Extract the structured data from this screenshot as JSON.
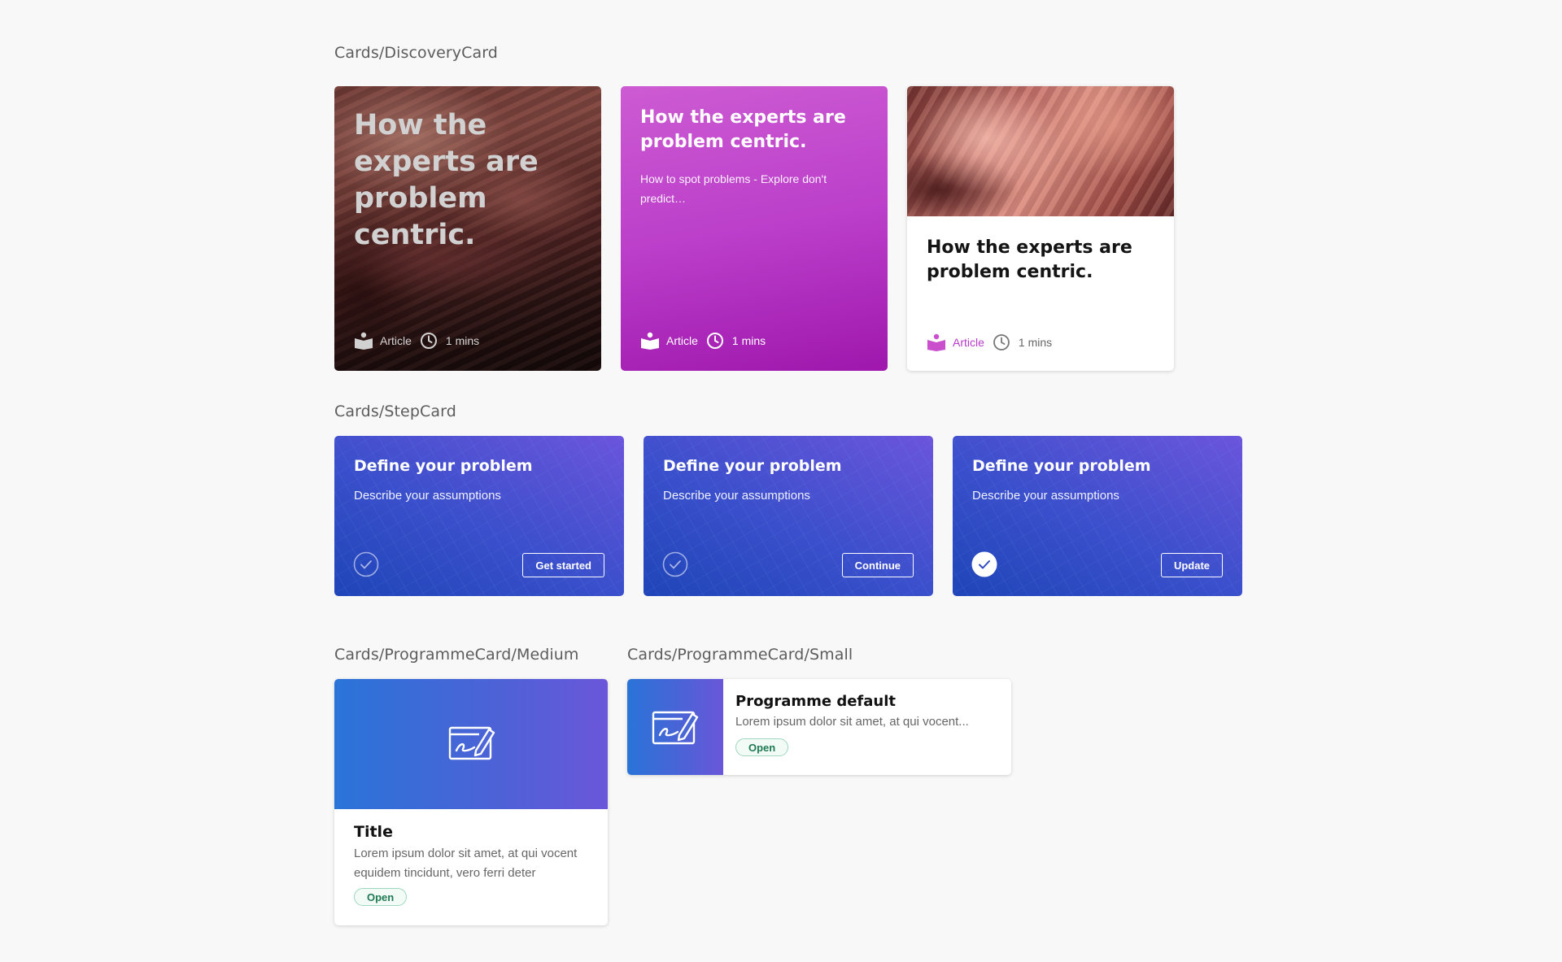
{
  "sections": {
    "discovery": "Cards/DiscoveryCard",
    "step": "Cards/StepCard",
    "programme_medium": "Cards/ProgrammeCard/Medium",
    "programme_small": "Cards/ProgrammeCard/Small"
  },
  "discovery_cards": [
    {
      "title": "How the experts are problem centric.",
      "type": "Article",
      "duration": "1 mins"
    },
    {
      "title": "How the experts are problem centric.",
      "description": "How to spot problems - Explore don't predict…",
      "type": "Article",
      "duration": "1 mins"
    },
    {
      "title": "How the experts are problem centric.",
      "type": "Article",
      "duration": "1 mins"
    }
  ],
  "step_cards": [
    {
      "title": "Define your problem",
      "subtitle": "Describe your assumptions",
      "button": "Get started",
      "completed": false
    },
    {
      "title": "Define your problem",
      "subtitle": "Describe your assumptions",
      "button": "Continue",
      "completed": false
    },
    {
      "title": "Define your problem",
      "subtitle": "Describe your assumptions",
      "button": "Update",
      "completed": true
    }
  ],
  "programme_medium": {
    "title": "Title",
    "description": "Lorem ipsum dolor sit amet, at qui vocent equidem tincidunt, vero ferri deter",
    "status": "Open"
  },
  "programme_small": {
    "title": "Programme default",
    "description": "Lorem ipsum dolor sit amet, at qui vocent...",
    "status": "Open"
  },
  "colors": {
    "background": "#f8f8f8",
    "discovery_magenta": "#b43cc6",
    "step_blue": "#2f4ac0",
    "programme_blue": "#3d6ad8",
    "status_green": "#1e7a54"
  },
  "icons": [
    "article-icon",
    "clock-icon",
    "check-circle-icon",
    "edit-document-icon"
  ]
}
